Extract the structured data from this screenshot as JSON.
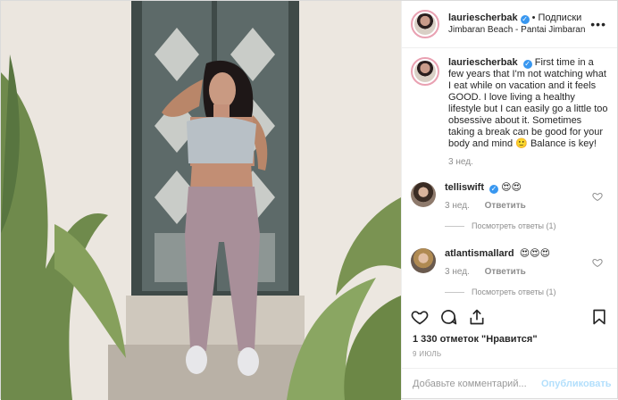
{
  "header": {
    "username": "lauriescherbak",
    "follow_label": "Подписки",
    "location": "Jimbaran Beach - Pantai Jimbaran",
    "more_label": "•••"
  },
  "caption": {
    "username": "lauriescherbak",
    "text": "First time in a few years that I'm not watching what I eat while on vacation and it feels GOOD. I love living a healthy lifestyle but I can easily go a little too obsessive about it. Sometimes taking a break can be good for your body and mind 🙂 Balance is key!",
    "time": "3 нед."
  },
  "comments": [
    {
      "username": "telliswift",
      "verified": true,
      "text": "😍😍",
      "time": "3 нед.",
      "reply_label": "Ответить",
      "replies_label": "Посмотреть ответы (1)"
    },
    {
      "username": "atlantismallard",
      "verified": false,
      "text": "😍😍😍",
      "time": "3 нед.",
      "reply_label": "Ответить",
      "replies_label": "Посмотреть ответы (1)"
    }
  ],
  "likes": "1 330 отметок \"Нравится\"",
  "date": "9 ИЮЛЬ",
  "comment_input": {
    "placeholder": "Добавьте комментарий...",
    "publish_label": "Опубликовать"
  },
  "colors": {
    "verified": "#3897f0",
    "publish": "#b2dffc",
    "muted": "#8e8e8e"
  },
  "icons": [
    "heart-icon",
    "comment-icon",
    "share-icon",
    "bookmark-icon",
    "verified-icon"
  ]
}
